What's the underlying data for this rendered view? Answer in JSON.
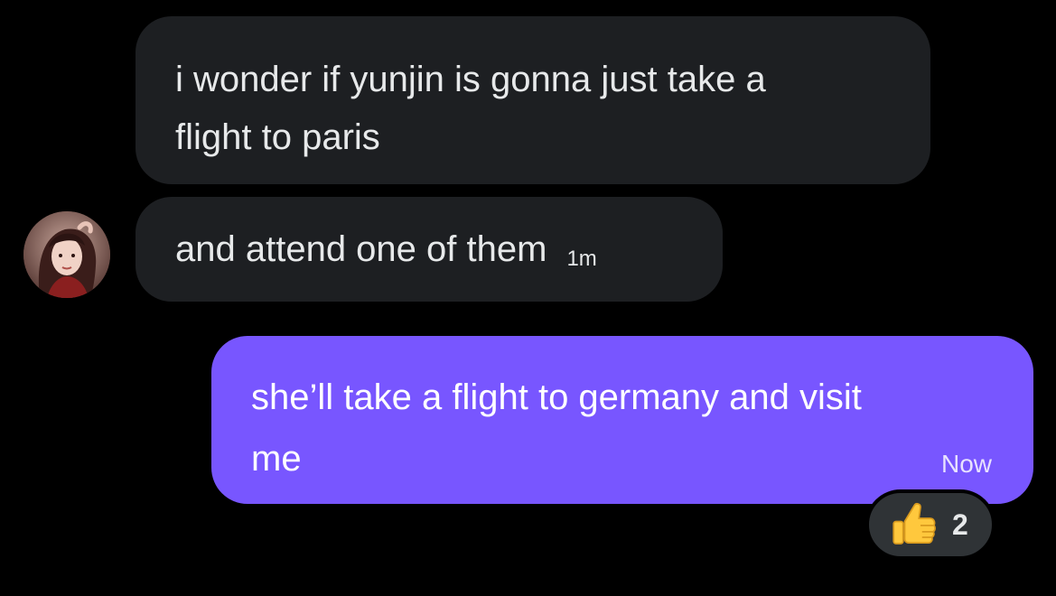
{
  "conversation": {
    "messages": [
      {
        "direction": "incoming",
        "text": "i wonder if yunjin is gonna just take a flight to paris",
        "line1": "i wonder if yunjin is gonna just take a",
        "line2": "flight to paris"
      },
      {
        "direction": "incoming",
        "text": "and attend one of them",
        "time": "1m",
        "avatar": "user-avatar"
      },
      {
        "direction": "outgoing",
        "text": "she’ll take a flight to germany and visit me",
        "line1": "she’ll take a flight to germany and visit",
        "line2": "me",
        "time": "Now",
        "reaction": {
          "emoji_icon": "thumbs-up-icon",
          "count": "2"
        }
      }
    ]
  },
  "colors": {
    "background": "#000000",
    "incoming_bubble": "#1d1f22",
    "outgoing_bubble": "#7856ff",
    "reaction_pill": "#2f3336",
    "text": "#e7e9ea"
  }
}
